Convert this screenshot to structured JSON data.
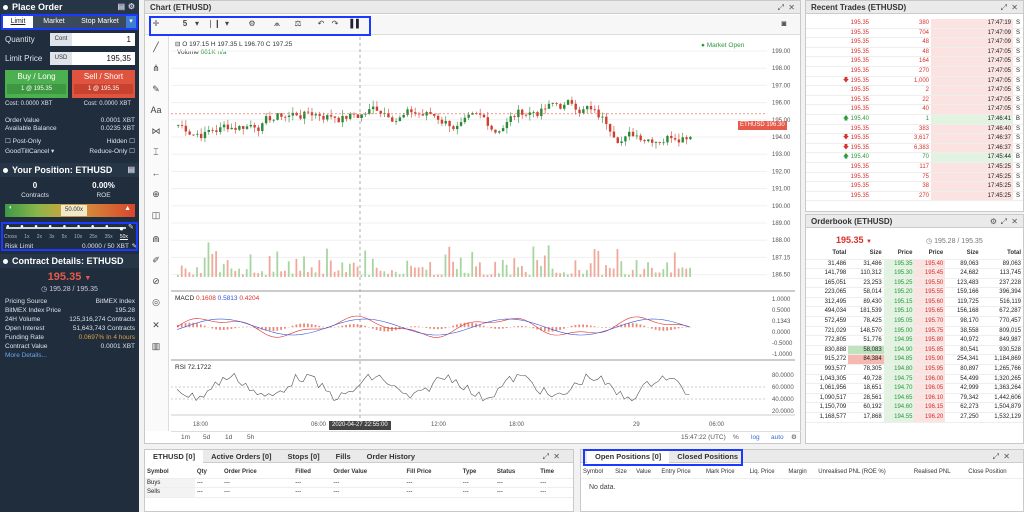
{
  "order": {
    "title": "Place Order",
    "tabs": [
      "Limit",
      "Market",
      "Stop Market"
    ],
    "quantity_label": "Quantity",
    "quantity_unit": "Cont",
    "quantity_value": "1",
    "price_label": "Limit Price",
    "price_unit": "USD",
    "price_value": "195,35",
    "buy_label": "Buy / Long",
    "buy_sub": "1 @ 195.35",
    "sell_label": "Sell / Short",
    "sell_sub": "1 @ 195.35",
    "cost_buy": "Cost: 0.0000 XBT",
    "cost_sell": "Cost: 0.0000 XBT",
    "order_value_label": "Order Value",
    "order_value": "0.0001 XBT",
    "balance_label": "Available Balance",
    "balance": "0.0235 XBT",
    "post_only": "Post-Only",
    "hidden": "Hidden",
    "gtc": "GoodTillCancel",
    "reduce_only": "Reduce-Only"
  },
  "position": {
    "title": "Your Position: ETHUSD",
    "contracts_value": "0",
    "contracts_label": "Contracts",
    "roe_value": "0.00%",
    "roe_label": "ROE",
    "liq_value": "50.00x",
    "leverage_ticks": [
      "Cross",
      "1x",
      "2x",
      "3x",
      "5x",
      "10x",
      "25x",
      "35x",
      "50x"
    ],
    "risk_label": "Risk Limit",
    "risk_value": "0.0000 / 50 XBT"
  },
  "contract": {
    "title": "Contract Details: ETHUSD",
    "price": "195.35",
    "sub_price": "195.28 / 195.35",
    "rows": [
      [
        "Pricing Source",
        "BitMEX Index"
      ],
      [
        "BitMEX Index Price",
        "195.28"
      ],
      [
        "24H Volume",
        "125,316,274 Contracts"
      ],
      [
        "Open Interest",
        "51,643,743 Contracts"
      ],
      [
        "Funding Rate",
        "0.0697% In 4 hours"
      ],
      [
        "Contract Value",
        "0.0001 XBT"
      ]
    ],
    "more": "More Details..."
  },
  "chart": {
    "title": "Chart (ETHUSD)",
    "interval": "5",
    "ohlc": "O 197.15  H 197.35  L 196.70  C 197.25",
    "volume_label": "Volume",
    "volume_value": "661K n/a",
    "market_open": "Market Open",
    "price_tag": "196.30",
    "symbol_tag": "ETHUSD",
    "y_ticks": [
      "199.00",
      "198.00",
      "197.00",
      "196.00",
      "195.00",
      "194.00",
      "193.00",
      "192.00",
      "191.00",
      "190.00",
      "189.00",
      "188.00",
      "187.15",
      "186.50"
    ],
    "macd_label": "MACD",
    "macd_values": [
      "0.1608",
      "0.5813",
      "0.4204"
    ],
    "macd_ticks": [
      "1.0000",
      "0.5000",
      "0.1343",
      "0.0000",
      "-0.5000",
      "-1.0000"
    ],
    "rsi_label": "RSI",
    "rsi_value": "72.1722",
    "rsi_ticks": [
      "80.0000",
      "60.0000",
      "40.0000",
      "20.0000"
    ],
    "x_ticks": [
      "18:00",
      "06:00",
      "12:00",
      "18:00",
      "29",
      "06:00"
    ],
    "crosshair_time": "2020-04-27 22:55:00",
    "ranges": [
      "1m",
      "5d",
      "1d",
      "5h"
    ],
    "clock": "15:47:22 (UTC)",
    "pct": "%",
    "log": "log",
    "auto": "auto"
  },
  "recent": {
    "title": "Recent Trades (ETHUSD)",
    "rows": [
      [
        "195.35",
        "380",
        "17:47:19",
        "S"
      ],
      [
        "195.35",
        "704",
        "17:47:09",
        "S"
      ],
      [
        "195.35",
        "48",
        "17:47:09",
        "S"
      ],
      [
        "195.35",
        "48",
        "17:47:05",
        "S"
      ],
      [
        "195.35",
        "164",
        "17:47:05",
        "S"
      ],
      [
        "195.35",
        "270",
        "17:47:05",
        "S"
      ],
      [
        "195.35",
        "1,000",
        "17:47:05",
        "S"
      ],
      [
        "195.35",
        "2",
        "17:47:05",
        "S"
      ],
      [
        "195.35",
        "22",
        "17:47:05",
        "S"
      ],
      [
        "195.35",
        "40",
        "17:47:05",
        "S"
      ],
      [
        "195.40",
        "1",
        "17:46:41",
        "B"
      ],
      [
        "195.35",
        "383",
        "17:46:40",
        "S"
      ],
      [
        "195.35",
        "3,617",
        "17:46:37",
        "S"
      ],
      [
        "195.35",
        "6,383",
        "17:46:37",
        "S"
      ],
      [
        "195.40",
        "70",
        "17:45:44",
        "B"
      ],
      [
        "195.35",
        "117",
        "17:45:25",
        "S"
      ],
      [
        "195.35",
        "75",
        "17:45:25",
        "S"
      ],
      [
        "195.35",
        "38",
        "17:45:25",
        "S"
      ],
      [
        "195.35",
        "270",
        "17:45:25",
        "S"
      ]
    ]
  },
  "orderbook": {
    "title": "Orderbook (ETHUSD)",
    "mark": "195.35",
    "index": "195.28 / 195.35",
    "headers": [
      "Total",
      "Size",
      "Price",
      "Price",
      "Size",
      "Total"
    ],
    "rows": [
      [
        "31,486",
        "31,486",
        "195.35",
        "195.40",
        "89,063",
        "89,063"
      ],
      [
        "141,798",
        "110,312",
        "195.30",
        "195.45",
        "24,682",
        "113,745"
      ],
      [
        "165,051",
        "23,253",
        "195.25",
        "195.50",
        "123,483",
        "237,228"
      ],
      [
        "223,065",
        "58,014",
        "195.20",
        "195.55",
        "159,166",
        "396,394"
      ],
      [
        "312,495",
        "89,430",
        "195.15",
        "195.60",
        "119,725",
        "516,119"
      ],
      [
        "494,034",
        "181,539",
        "195.10",
        "195.65",
        "156,168",
        "672,287"
      ],
      [
        "572,459",
        "78,425",
        "195.05",
        "195.70",
        "98,170",
        "770,457"
      ],
      [
        "721,029",
        "148,570",
        "195.00",
        "195.75",
        "38,558",
        "809,015"
      ],
      [
        "772,805",
        "51,776",
        "194.95",
        "195.80",
        "40,972",
        "849,987"
      ],
      [
        "830,888",
        "58,083",
        "194.90",
        "195.85",
        "80,541",
        "930,528"
      ],
      [
        "915,272",
        "84,384",
        "194.85",
        "195.90",
        "254,341",
        "1,184,869"
      ],
      [
        "993,577",
        "78,305",
        "194.80",
        "195.95",
        "80,897",
        "1,265,766"
      ],
      [
        "1,043,305",
        "49,728",
        "194.75",
        "196.00",
        "54,499",
        "1,320,265"
      ],
      [
        "1,061,956",
        "18,651",
        "194.70",
        "196.05",
        "42,999",
        "1,363,264"
      ],
      [
        "1,090,517",
        "28,561",
        "194.65",
        "196.10",
        "79,342",
        "1,442,606"
      ],
      [
        "1,150,709",
        "60,192",
        "194.60",
        "196.15",
        "62,273",
        "1,504,879"
      ],
      [
        "1,168,577",
        "17,868",
        "194.55",
        "196.20",
        "27,250",
        "1,532,129"
      ]
    ]
  },
  "orders": {
    "tabs": [
      "ETHUSD [0]",
      "Active Orders [0]",
      "Stops [0]",
      "Fills",
      "Order History"
    ],
    "cols": [
      "Symbol",
      "Qty",
      "Order Price",
      "Filled",
      "Order Value",
      "Fill Price",
      "Type",
      "Status",
      "Time"
    ],
    "rows": [
      [
        "Buys",
        "---",
        "---",
        "---",
        "---",
        "---",
        "---",
        "---",
        "---"
      ],
      [
        "Sells",
        "---",
        "---",
        "---",
        "---",
        "---",
        "---",
        "---",
        "---"
      ]
    ]
  },
  "positions": {
    "tabs": [
      "Open Positions [0]",
      "Closed Positions"
    ],
    "cols": [
      "Symbol",
      "Size",
      "Value",
      "Entry Price",
      "Mark Price",
      "Liq. Price",
      "Margin",
      "Unrealised PNL (ROE %)",
      "Realised PNL",
      "Close Position"
    ],
    "empty": "No data."
  }
}
